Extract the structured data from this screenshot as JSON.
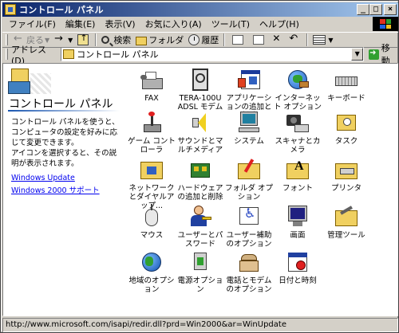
{
  "window": {
    "title": "コントロール パネル",
    "title_buttons": [
      "_",
      "□",
      "×"
    ]
  },
  "menubar": {
    "items": [
      "ファイル(F)",
      "編集(E)",
      "表示(V)",
      "お気に入り(A)",
      "ツール(T)",
      "ヘルプ(H)"
    ]
  },
  "toolbar": {
    "back": "戻る",
    "search": "検索",
    "folders": "フォルダ",
    "history": "履歴"
  },
  "addressbar": {
    "label": "アドレス(D)",
    "value": "コントロール パネル",
    "go": "移動"
  },
  "sidebar": {
    "title": "コントロール パネル",
    "desc1": "コントロール パネルを使うと、コンピュータの設定を好みに応じて変更できます。",
    "desc2": "アイコンを選択すると、その説明が表示されます。",
    "links": [
      "Windows Update",
      "Windows 2000 サポート"
    ]
  },
  "items": [
    {
      "label": "FAX",
      "icon": "fax-icon"
    },
    {
      "label": "TERA-100U ADSL モデム",
      "icon": "modem-icon"
    },
    {
      "label": "アプリケーションの追加と削除",
      "icon": "add-remove-programs-icon"
    },
    {
      "label": "インターネット オプション",
      "icon": "internet-options-icon"
    },
    {
      "label": "キーボード",
      "icon": "keyboard-icon"
    },
    {
      "label": "ゲーム コントローラ",
      "icon": "game-controller-icon"
    },
    {
      "label": "サウンドとマルチメディア",
      "icon": "sound-icon"
    },
    {
      "label": "システム",
      "icon": "system-icon"
    },
    {
      "label": "スキャナとカメラ",
      "icon": "scanner-camera-icon"
    },
    {
      "label": "タスク",
      "icon": "scheduled-tasks-icon"
    },
    {
      "label": "ネットワークとダイヤルアップ...",
      "icon": "network-icon"
    },
    {
      "label": "ハードウェアの追加と削除",
      "icon": "add-hardware-icon"
    },
    {
      "label": "フォルダ オプション",
      "icon": "folder-options-icon"
    },
    {
      "label": "フォント",
      "icon": "fonts-icon"
    },
    {
      "label": "プリンタ",
      "icon": "printers-icon"
    },
    {
      "label": "マウス",
      "icon": "mouse-icon"
    },
    {
      "label": "ユーザーとパスワード",
      "icon": "users-passwords-icon"
    },
    {
      "label": "ユーザー補助のオプション",
      "icon": "accessibility-icon"
    },
    {
      "label": "画面",
      "icon": "display-icon"
    },
    {
      "label": "管理ツール",
      "icon": "admin-tools-icon"
    },
    {
      "label": "地域のオプション",
      "icon": "regional-options-icon"
    },
    {
      "label": "電源オプション",
      "icon": "power-options-icon"
    },
    {
      "label": "電話とモデムのオプション",
      "icon": "phone-modem-icon"
    },
    {
      "label": "日付と時刻",
      "icon": "date-time-icon"
    }
  ],
  "statusbar": {
    "text": "http://www.microsoft.com/isapi/redir.dll?prd=Win2000&ar=WinUpdate"
  }
}
